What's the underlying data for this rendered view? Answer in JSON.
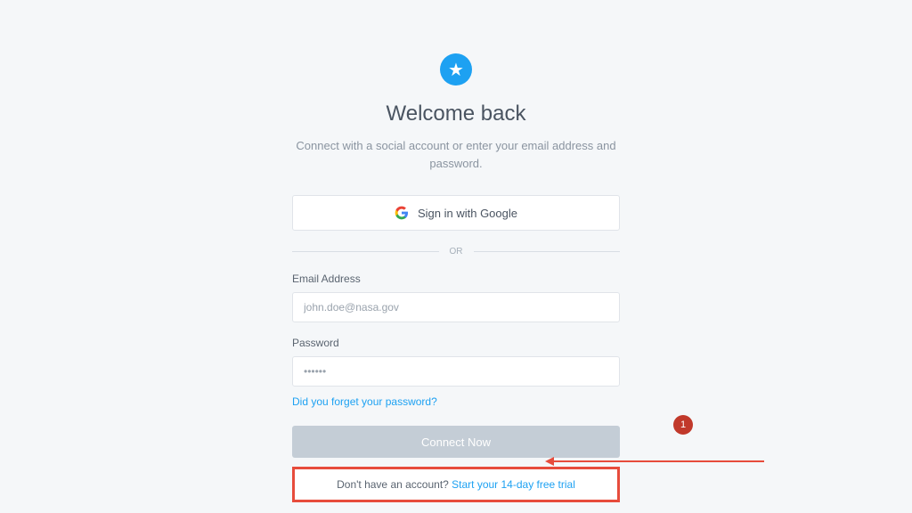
{
  "header": {
    "title": "Welcome back",
    "subtitle": "Connect with a social account or enter your email address and password."
  },
  "social": {
    "google_label": "Sign in with Google"
  },
  "divider": {
    "text": "OR"
  },
  "form": {
    "email_label": "Email Address",
    "email_placeholder": "john.doe@nasa.gov",
    "email_value": "",
    "password_label": "Password",
    "password_placeholder": "••••••",
    "password_value": "",
    "forgot_text": "Did you forget your password?",
    "submit_label": "Connect Now"
  },
  "signup": {
    "prompt": "Don't have an account? ",
    "link_text": "Start your 14-day free trial"
  },
  "annotation": {
    "badge": "1"
  },
  "colors": {
    "brand": "#1da1f2",
    "highlight": "#e74c3c",
    "badge": "#c1392b"
  }
}
